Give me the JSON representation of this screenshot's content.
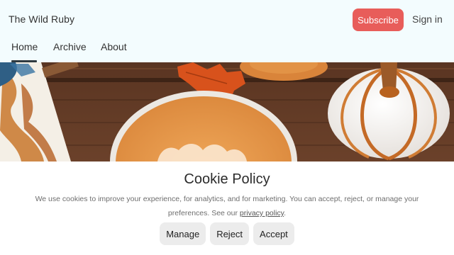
{
  "header": {
    "site_title": "The Wild Ruby",
    "subscribe_label": "Subscribe",
    "signin_label": "Sign in"
  },
  "nav": {
    "items": [
      {
        "label": "Home",
        "active": true
      },
      {
        "label": "Archive",
        "active": false
      },
      {
        "label": "About",
        "active": false
      }
    ]
  },
  "colors": {
    "header_bg": "#f3fcfe",
    "accent": "#e85d5a",
    "button_bg": "#ececec"
  },
  "cookie": {
    "title": "Cookie Policy",
    "text_before_link": "We use cookies to improve your experience, for analytics, and for marketing. You can accept, reject, or manage your preferences. See our ",
    "link_label": "privacy policy",
    "text_after_link": ".",
    "buttons": {
      "manage": "Manage",
      "reject": "Reject",
      "accept": "Accept"
    }
  }
}
